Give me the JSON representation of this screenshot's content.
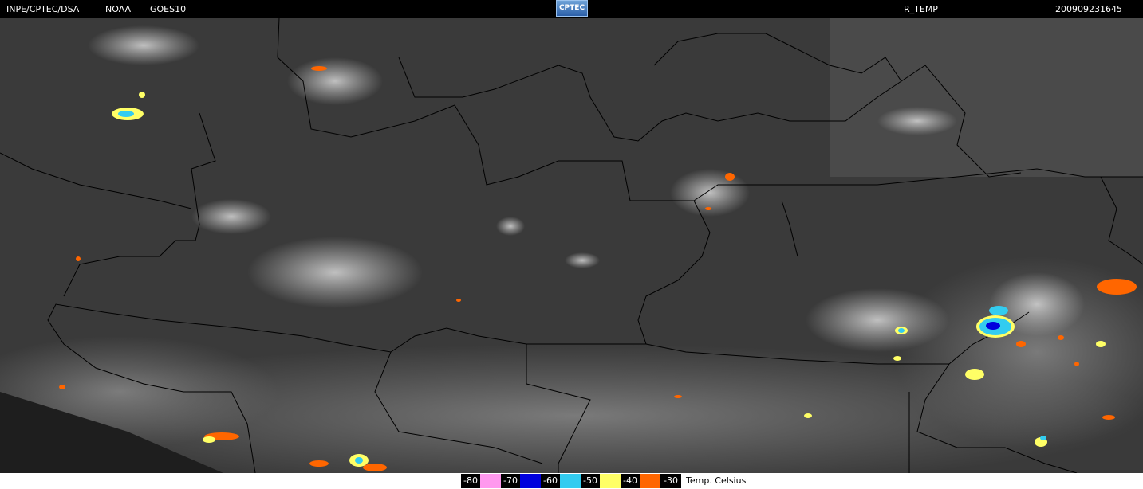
{
  "header": {
    "agency": "INPE/CPTEC/DSA",
    "source": "NOAA",
    "satellite": "GOES10",
    "logo_text": "CPTEC",
    "product": "R_TEMP",
    "timestamp": "200909231645"
  },
  "legend": {
    "items": [
      {
        "label": "-80",
        "color": "#ff99ee"
      },
      {
        "label": "-70",
        "color": "#0000dd"
      },
      {
        "label": "-60",
        "color": "#33ccf0"
      },
      {
        "label": "-50",
        "color": "#ffff66"
      },
      {
        "label": "-40",
        "color": "#ff6600"
      },
      {
        "label": "-30",
        "color": null
      }
    ],
    "unit": "Temp. Celsius"
  },
  "map": {
    "background_color": "#3a3a3a",
    "border_color": "#000000"
  }
}
